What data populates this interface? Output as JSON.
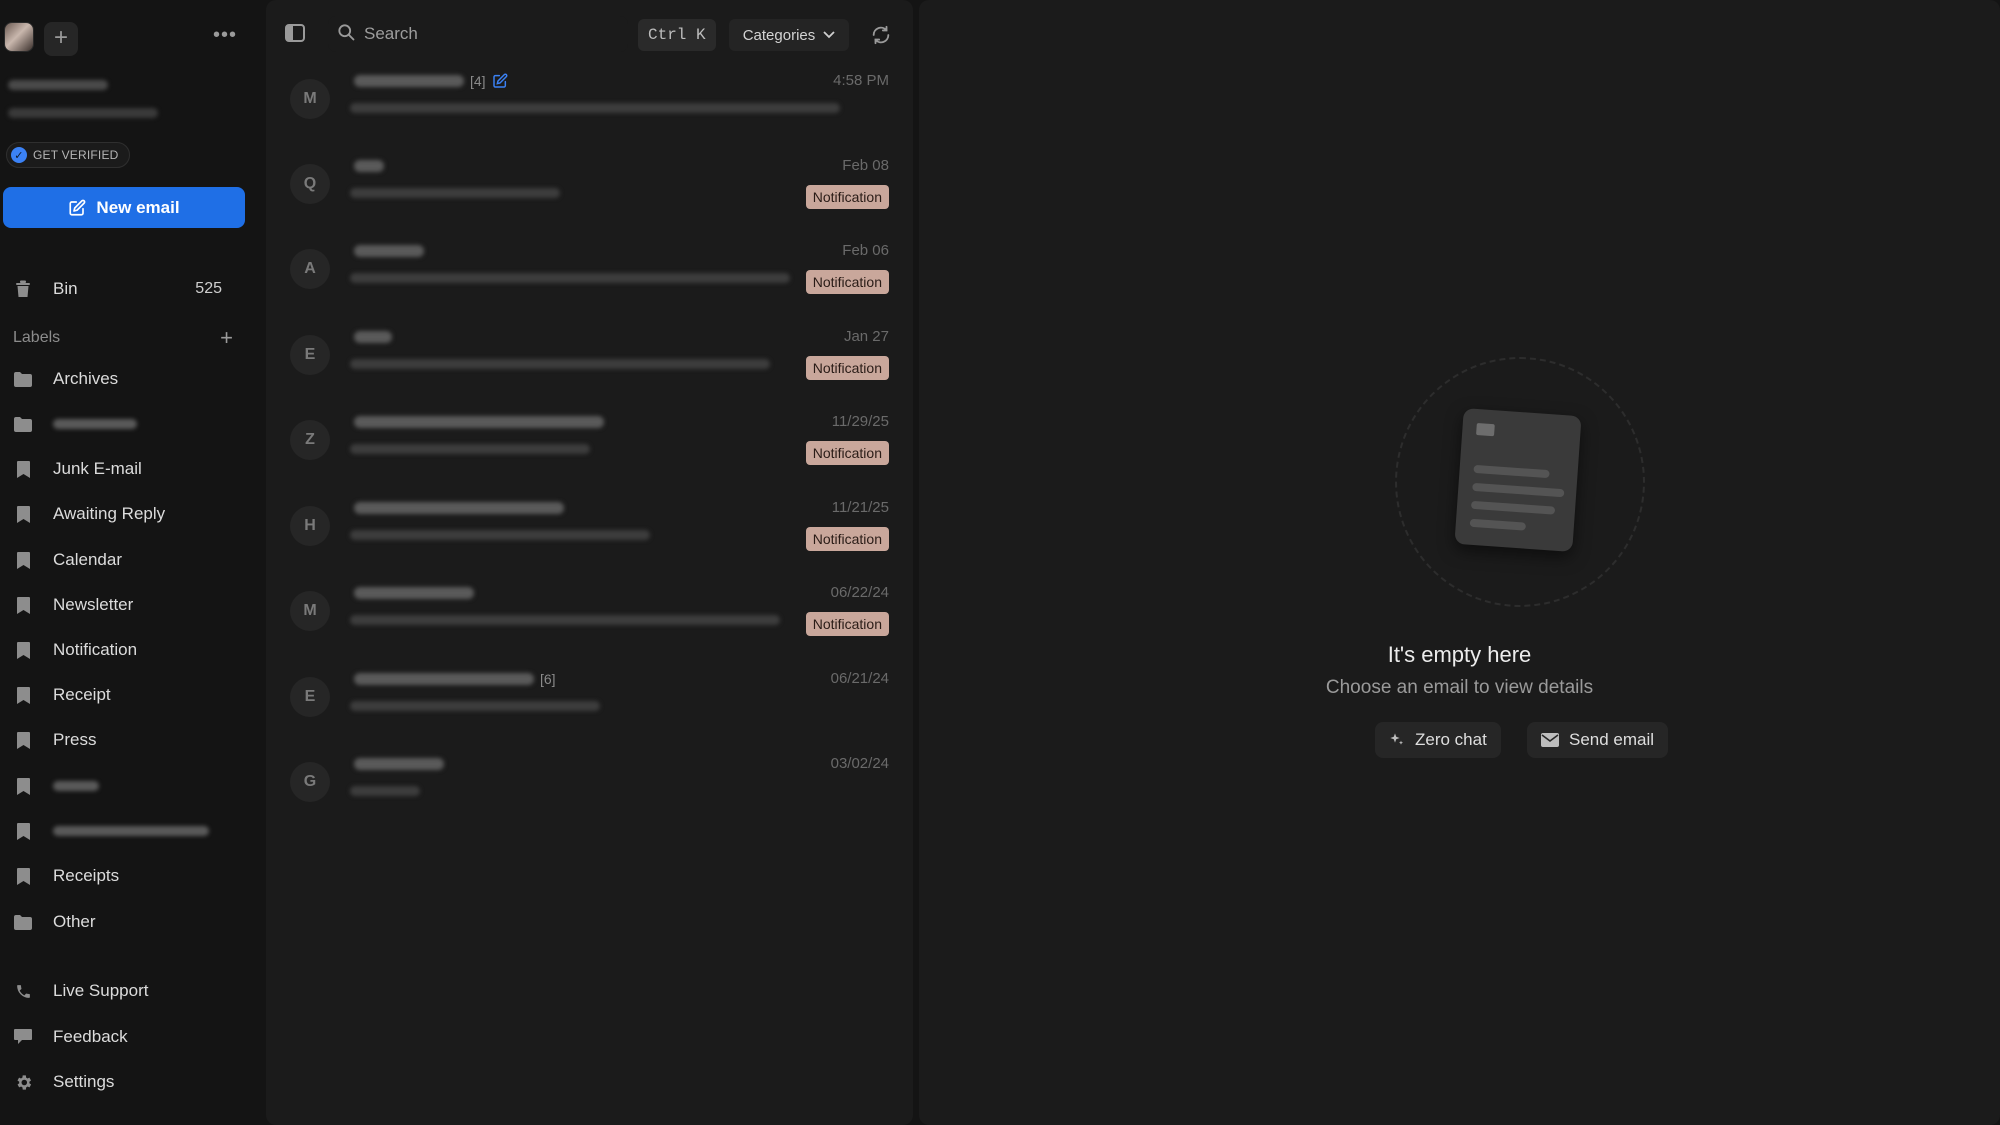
{
  "account": {
    "more_label": "•••",
    "add_label": "+",
    "verify_label": "GET VERIFIED"
  },
  "compose": {
    "label": "New email"
  },
  "folders": [
    {
      "label": "Bin",
      "count": "525",
      "icon": "trash-icon"
    }
  ],
  "labels_header": {
    "title": "Labels",
    "add": "+"
  },
  "labels": [
    {
      "label": "Archives",
      "icon": "folder-icon"
    },
    {
      "label": "",
      "icon": "folder-icon",
      "blurred": true
    },
    {
      "label": "Junk E-mail",
      "icon": "bookmark-icon"
    },
    {
      "label": "Awaiting Reply",
      "icon": "bookmark-icon"
    },
    {
      "label": "Calendar",
      "icon": "bookmark-icon"
    },
    {
      "label": "Newsletter",
      "icon": "bookmark-icon"
    },
    {
      "label": "Notification",
      "icon": "bookmark-icon"
    },
    {
      "label": "Receipt",
      "icon": "bookmark-icon"
    },
    {
      "label": "Press",
      "icon": "bookmark-icon"
    },
    {
      "label": "",
      "icon": "bookmark-icon",
      "blurred": true
    },
    {
      "label": "",
      "icon": "bookmark-icon",
      "blurred": true
    },
    {
      "label": "Receipts",
      "icon": "bookmark-icon"
    },
    {
      "label": "Other",
      "icon": "folder-icon"
    }
  ],
  "footer_nav": [
    {
      "label": "Live Support",
      "icon": "phone-icon"
    },
    {
      "label": "Feedback",
      "icon": "message-icon"
    },
    {
      "label": "Settings",
      "icon": "gear-icon"
    }
  ],
  "toolbar": {
    "search_placeholder": "Search",
    "shortcut": "Ctrl K",
    "categories_label": "Categories"
  },
  "emails": [
    {
      "initial": "M",
      "date": "4:58 PM",
      "thread_count": "[4]",
      "badge": "",
      "draft": true
    },
    {
      "initial": "Q",
      "date": "Feb 08",
      "thread_count": "",
      "badge": "Notification"
    },
    {
      "initial": "A",
      "date": "Feb 06",
      "thread_count": "",
      "badge": "Notification"
    },
    {
      "initial": "E",
      "date": "Jan 27",
      "thread_count": "",
      "badge": "Notification"
    },
    {
      "initial": "Z",
      "date": "11/29/25",
      "thread_count": "",
      "badge": "Notification"
    },
    {
      "initial": "H",
      "date": "11/21/25",
      "thread_count": "",
      "badge": "Notification"
    },
    {
      "initial": "M",
      "date": "06/22/24",
      "thread_count": "",
      "badge": "Notification"
    },
    {
      "initial": "E",
      "date": "06/21/24",
      "thread_count": "[6]",
      "badge": ""
    },
    {
      "initial": "G",
      "date": "03/02/24",
      "thread_count": "",
      "badge": ""
    }
  ],
  "empty_state": {
    "title": "It's empty here",
    "subtitle": "Choose an email to view details",
    "zero_chat_label": "Zero chat",
    "send_email_label": "Send email"
  },
  "colors": {
    "accent": "#1f6fe6",
    "badge_bg": "#c9a79b",
    "verify_dot": "#3b82f6"
  }
}
